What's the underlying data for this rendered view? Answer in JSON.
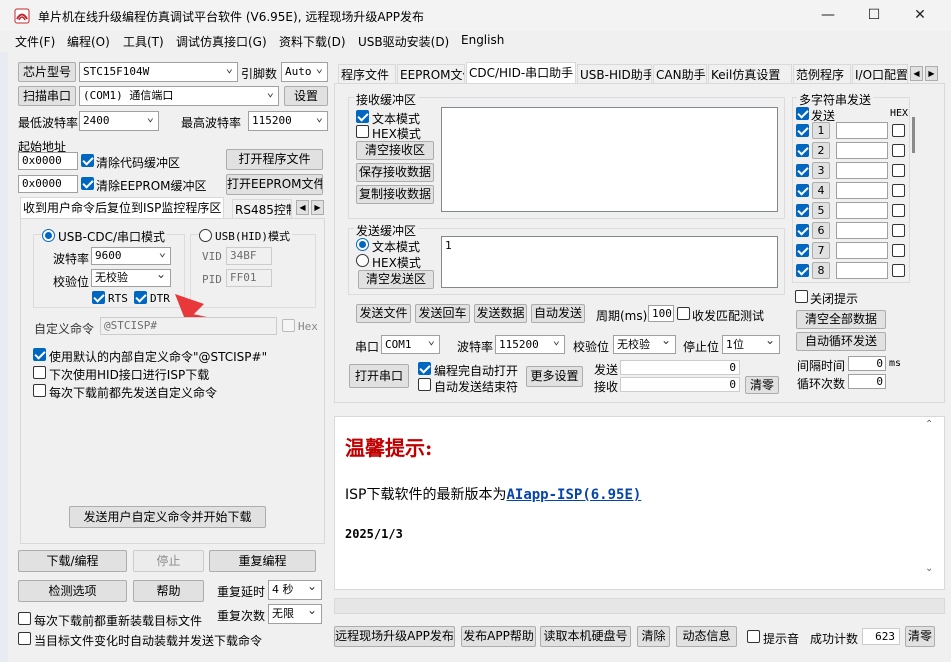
{
  "title": "单片机在线升级编程仿真调试平台软件 (V6.95E), 远程现场升级APP发布",
  "window_buttons": {
    "minimize": "—",
    "maximize": "☐",
    "close": "✕"
  },
  "menu": [
    "文件(F)",
    "编程(O)",
    "工具(T)",
    "调试仿真接口(G)",
    "资料下载(D)",
    "USB驱动安装(D)",
    "English"
  ],
  "left": {
    "chip_label": "芯片型号",
    "chip_value": "STC15F104W",
    "pins_label": "引脚数",
    "pins_value": "Auto",
    "scan_label": "扫描串口",
    "port_value": "(COM1) 通信端口",
    "settings_label": "设置",
    "min_baud_label": "最低波特率",
    "min_baud_value": "2400",
    "max_baud_label": "最高波特率",
    "max_baud_value": "115200",
    "start_addr_label": "起始地址",
    "addr1": "0x0000",
    "clear_code_label": "清除代码缓冲区",
    "open_prog_label": "打开程序文件",
    "addr2": "0x0000",
    "clear_eeprom_label": "清除EEPROM缓冲区",
    "open_eeprom_label": "打开EEPROM文件",
    "tabs": [
      "收到用户命令后复位到ISP监控程序区",
      "RS485控制"
    ],
    "usb_cdc_label": "USB-CDC/串口模式",
    "usb_hid_label": "USB(HID)模式",
    "baud_label": "波特率",
    "baud_value": "9600",
    "vid_label": "VID",
    "vid_value": "34BF",
    "parity_label": "校验位",
    "parity_value": "无校验",
    "pid_label": "PID",
    "pid_value": "FF01",
    "rts_label": "RTS",
    "dtr_label": "DTR",
    "custom_cmd_label": "自定义命令",
    "custom_cmd_value": "@STCISP#",
    "hex_label": "Hex",
    "opt1": "使用默认的内部自定义命令\"@STCISP#\"",
    "opt2": "下次使用HID接口进行ISP下载",
    "opt3": "每次下载前都先发送自定义命令",
    "send_custom_label": "发送用户自定义命令并开始下载",
    "download_label": "下载/编程",
    "stop_label": "停止",
    "reprogram_label": "重复编程",
    "check_label": "检测选项",
    "help_label": "帮助",
    "repeat_delay_label": "重复延时",
    "repeat_delay_value": "4 秒",
    "repeat_count_label": "重复次数",
    "repeat_count_value": "无限",
    "reload_label": "每次下载前都重新装载目标文件",
    "autoload_label": "当目标文件变化时自动装载并发送下载命令"
  },
  "right": {
    "tabs": [
      "程序文件",
      "EEPROM文件",
      "CDC/HID-串口助手",
      "USB-HID助手",
      "CAN助手",
      "Keil仿真设置",
      "范例程序",
      "I/O口配置"
    ],
    "recv_title": "接收缓冲区",
    "text_mode": "文本模式",
    "hex_mode": "HEX模式",
    "clear_recv": "清空接收区",
    "save_recv": "保存接收数据",
    "copy_recv": "复制接收数据",
    "send_title": "发送缓冲区",
    "send_text": "1",
    "clear_send": "清空发送区",
    "send_file": "发送文件",
    "send_back": "发送回车",
    "send_data": "发送数据",
    "auto_send": "自动发送",
    "period_label": "周期(ms)",
    "period_value": "100",
    "match_label": "收发匹配测试",
    "port_label": "串口",
    "port_value": "COM1",
    "baud_label": "波特率",
    "baud_value": "115200",
    "parity_label": "校验位",
    "parity_value": "无校验",
    "stop_label": "停止位",
    "stop_value": "1位",
    "open_port": "打开串口",
    "open_after": "编程完自动打开",
    "auto_send_end": "自动发送结束符",
    "more_settings": "更多设置",
    "sent_label": "发送",
    "sent_value": "0",
    "recv_label": "接收",
    "recv_value": "0",
    "clear_count": "清零",
    "multi_title": "多字符串发送",
    "multi_send": "发送",
    "multi_hex": "HEX",
    "multi_rows": [
      "1",
      "2",
      "3",
      "4",
      "5",
      "6",
      "7",
      "8"
    ],
    "close_tip": "关闭提示",
    "clear_all": "清空全部数据",
    "auto_loop": "自动循环发送",
    "interval_label": "间隔时间",
    "interval_value": "0",
    "interval_unit": "ms",
    "loop_label": "循环次数",
    "loop_value": "0",
    "tip_title": "温馨提示:",
    "tip_text": "ISP下载软件的最新版本为",
    "tip_link": "AIapp-ISP(6.95E)",
    "tip_date": "2025/1/3",
    "bottom": {
      "remote": "远程现场升级APP发布",
      "publish_help": "发布APP帮助",
      "read_disk": "读取本机硬盘号",
      "clear": "清除",
      "animation": "动态信息",
      "beep": "提示音",
      "success_label": "成功计数",
      "success_value": "623",
      "clear_count": "清零"
    }
  },
  "colors": {
    "accent": "#0067c0",
    "tip_red": "#c00000",
    "link": "#0645ad",
    "arrow": "#e8383a"
  }
}
